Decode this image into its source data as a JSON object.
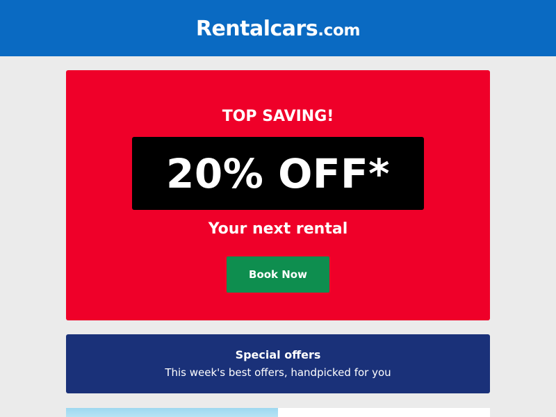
{
  "header": {
    "logo_main": "Rentalcars",
    "logo_domain": ".com",
    "background_color": "#0a6ac2"
  },
  "promo": {
    "eyebrow": "TOP SAVING!",
    "discount": "20% OFF*",
    "subtitle": "Your next rental",
    "cta_label": "Book Now",
    "background_color": "#ef0029",
    "cta_color": "#0e8e4f"
  },
  "offers": {
    "title": "Special offers",
    "subtitle": "This week's best offers, handpicked for you",
    "background_color": "#1a3179"
  }
}
